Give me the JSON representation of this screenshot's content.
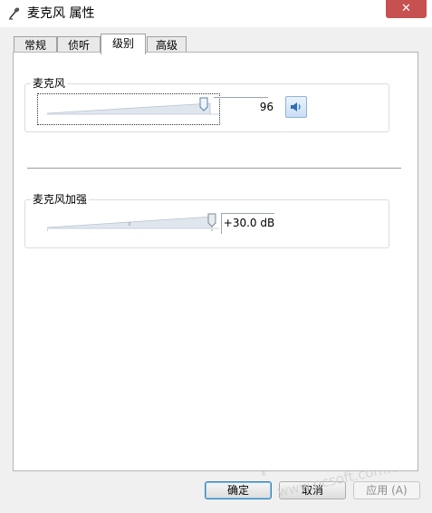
{
  "window": {
    "title": "麦克风 属性",
    "close_label": "✕"
  },
  "tabs": [
    {
      "label": "常规",
      "active": false
    },
    {
      "label": "侦听",
      "active": false
    },
    {
      "label": "级别",
      "active": true
    },
    {
      "label": "高级",
      "active": false
    }
  ],
  "microphone": {
    "label": "麦克风",
    "value": "96",
    "level_percent": 96,
    "mute_icon": "speaker-icon"
  },
  "boost": {
    "label": "麦克风加强",
    "value": "+30.0 dB",
    "level_fraction": 1.0
  },
  "buttons": {
    "ok": "确定",
    "cancel": "取消",
    "apply": "应用 (A)"
  },
  "watermark": {
    "logo_text": "PC下载网",
    "url_text": "www.pcsoft.com.cn"
  }
}
